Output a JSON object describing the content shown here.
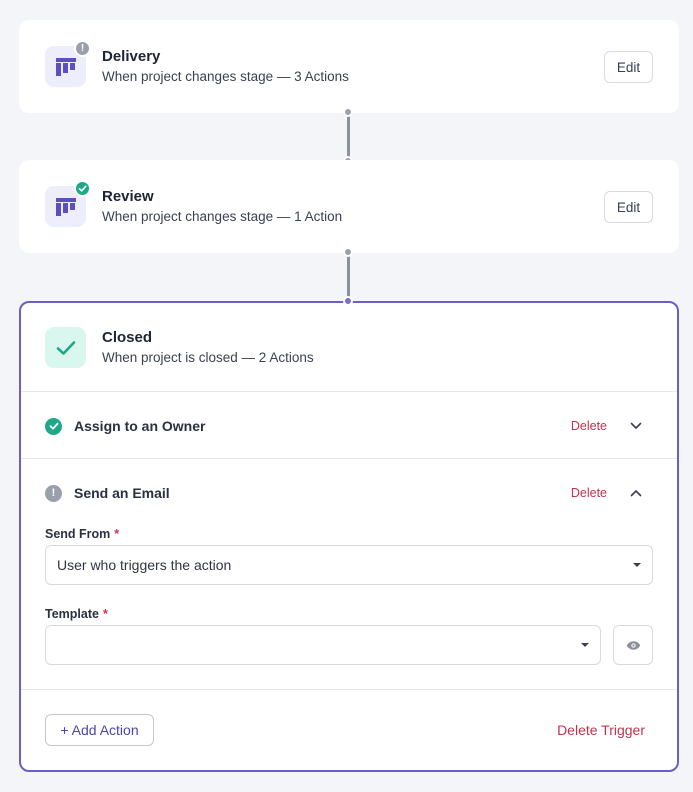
{
  "stages": [
    {
      "title": "Delivery",
      "subtitle": "When project changes stage — 3 Actions",
      "status": "warning",
      "icon": "board-icon",
      "edit_label": "Edit"
    },
    {
      "title": "Review",
      "subtitle": "When project changes stage — 1 Action",
      "status": "complete",
      "icon": "board-icon",
      "edit_label": "Edit"
    }
  ],
  "closed": {
    "title": "Closed",
    "subtitle": "When project is closed — 2 Actions",
    "icon": "check-icon",
    "actions": [
      {
        "label": "Assign to an Owner",
        "status": "complete",
        "delete_label": "Delete",
        "expanded": false
      },
      {
        "label": "Send an Email",
        "status": "warning",
        "delete_label": "Delete",
        "expanded": true
      }
    ],
    "form": {
      "send_from_label": "Send From",
      "send_from_value": "User who triggers the action",
      "template_label": "Template",
      "template_value": "",
      "required_mark": "*"
    },
    "add_action_label": "+ Add Action",
    "delete_trigger_label": "Delete Trigger"
  },
  "colors": {
    "accent": "#6b5fc1",
    "success": "#1ea888",
    "danger": "#c0344f",
    "neutral": "#9aa0ab"
  }
}
